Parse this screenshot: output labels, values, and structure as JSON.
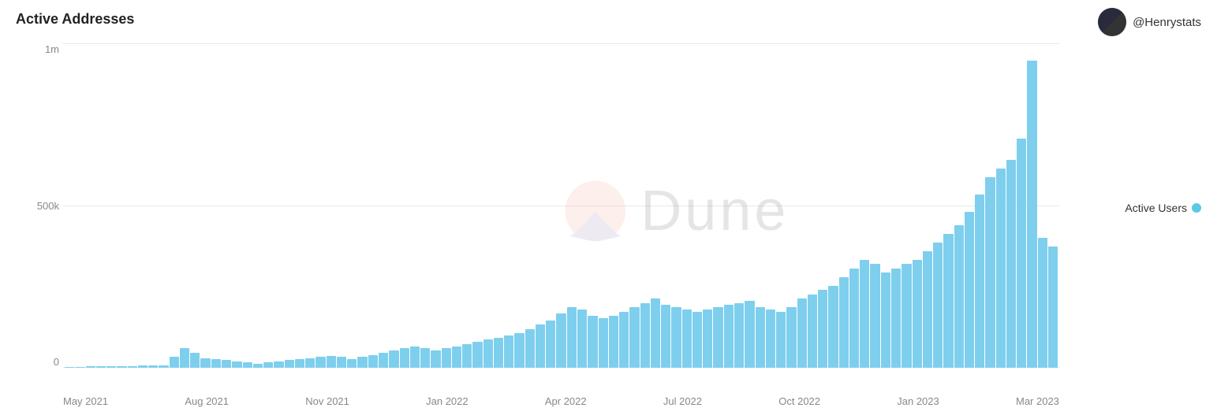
{
  "title": "Active Addresses",
  "username": "@Henrystats",
  "legend": {
    "label": "Active Users",
    "color": "#5bc8e8"
  },
  "watermark": "Dune",
  "yAxis": {
    "labels": [
      "1m",
      "500k",
      "0"
    ]
  },
  "xAxis": {
    "labels": [
      "May 2021",
      "Aug 2021",
      "Nov 2021",
      "Jan 2022",
      "Apr 2022",
      "Jul 2022",
      "Oct 2022",
      "Jan 2023",
      "Mar 2023"
    ]
  },
  "bars": [
    0.2,
    0.2,
    0.3,
    0.3,
    0.3,
    0.4,
    0.4,
    0.5,
    0.5,
    0.5,
    2.5,
    4.5,
    3.5,
    2.2,
    2.0,
    1.8,
    1.5,
    1.2,
    1.0,
    1.2,
    1.5,
    1.8,
    2.0,
    2.2,
    2.5,
    2.8,
    2.5,
    2.0,
    2.5,
    3.0,
    3.5,
    4.0,
    4.5,
    5.0,
    4.5,
    4.0,
    4.5,
    5.0,
    5.5,
    6.0,
    6.5,
    7.0,
    7.5,
    8.0,
    9.0,
    10.0,
    11.0,
    12.5,
    14.0,
    13.5,
    12.0,
    11.5,
    12.0,
    13.0,
    14.0,
    15.0,
    16.0,
    14.5,
    14.0,
    13.5,
    13.0,
    13.5,
    14.0,
    14.5,
    15.0,
    15.5,
    14.0,
    13.5,
    13.0,
    14.0,
    16.0,
    17.0,
    18.0,
    19.0,
    21.0,
    23.0,
    25.0,
    24.0,
    22.0,
    23.0,
    24.0,
    25.0,
    27.0,
    29.0,
    31.0,
    33.0,
    36.0,
    40.0,
    44.0,
    46.0,
    48.0,
    53.0,
    71.0,
    30.0,
    28.0
  ],
  "maxValue": 75
}
